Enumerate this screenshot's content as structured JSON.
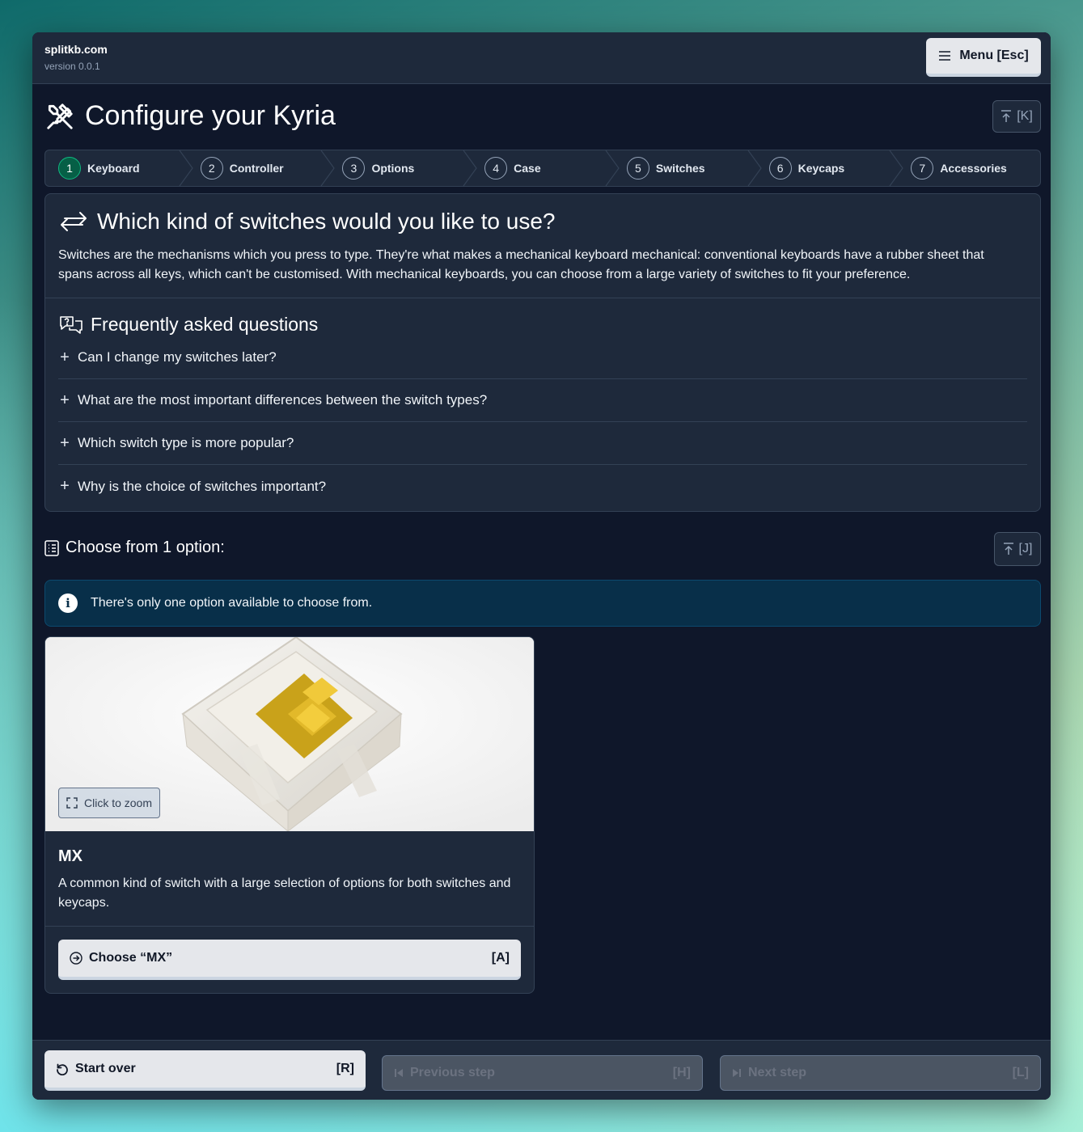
{
  "header": {
    "site_name": "splitkb.com",
    "version": "version 0.0.1",
    "menu_label": "Menu [Esc]"
  },
  "page": {
    "title": "Configure your Kyria",
    "jump_key": "[K]"
  },
  "steps": [
    {
      "num": "1",
      "label": "Keyboard",
      "active": true
    },
    {
      "num": "2",
      "label": "Controller"
    },
    {
      "num": "3",
      "label": "Options"
    },
    {
      "num": "4",
      "label": "Case"
    },
    {
      "num": "5",
      "label": "Switches"
    },
    {
      "num": "6",
      "label": "Keycaps"
    },
    {
      "num": "7",
      "label": "Accessories"
    }
  ],
  "question": {
    "title": "Which kind of switches would you like to use?",
    "description": "Switches are the mechanisms which you press to type. They're what makes a mechanical keyboard mechanical: conventional keyboards have a rubber sheet that spans across all keys, which can't be customised. With mechanical keyboards, you can choose from a large variety of switches to fit your preference."
  },
  "faq": {
    "title": "Frequently asked questions",
    "items": [
      "Can I change my switches later?",
      "What are the most important differences between the switch types?",
      "Which switch type is more popular?",
      "Why is the choice of switches important?"
    ]
  },
  "choose": {
    "title": "Choose from 1 option:",
    "jump_key": "[J]"
  },
  "info": {
    "text": "There's only one option available to choose from."
  },
  "option": {
    "zoom_label": "Click to zoom",
    "name": "MX",
    "description": "A common kind of switch with a large selection of options for both switches and keycaps.",
    "choose_label": "Choose “MX”",
    "choose_key": "[A]"
  },
  "footer": {
    "start_over": "Start over",
    "start_key": "[R]",
    "previous": "Previous step",
    "previous_key": "[H]",
    "next": "Next step",
    "next_key": "[L]"
  },
  "icons": [
    "tools-icon",
    "menu-icon",
    "arrow-up-to-line-icon",
    "arrows-exchange-icon",
    "chat-question-icon",
    "plus-icon",
    "list-icon",
    "info-icon",
    "expand-icon",
    "arrow-circle-right-icon",
    "rotate-ccw-icon",
    "skip-back-icon",
    "skip-forward-icon"
  ],
  "colors": {
    "active_step": "#065f46",
    "info_bg": "#082f49",
    "window_bg": "#0f172a",
    "panel_bg": "#1e293b"
  }
}
